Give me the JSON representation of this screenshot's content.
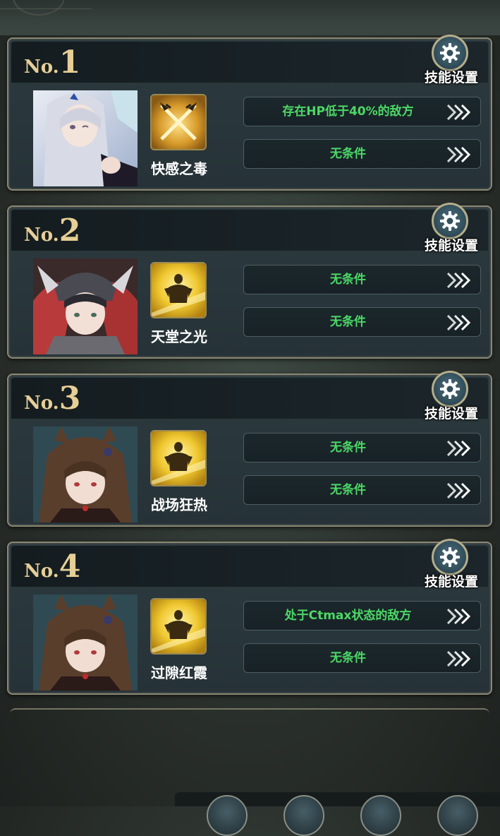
{
  "settings_label": "技能设置",
  "num_prefix": "No.",
  "slots": [
    {
      "number": "1",
      "skill_name": "快感之毒",
      "conditions": [
        "存在HP低于40%的敌方",
        "无条件"
      ]
    },
    {
      "number": "2",
      "skill_name": "天堂之光",
      "conditions": [
        "无条件",
        "无条件"
      ]
    },
    {
      "number": "3",
      "skill_name": "战场狂热",
      "conditions": [
        "无条件",
        "无条件"
      ]
    },
    {
      "number": "4",
      "skill_name": "过隙红霞",
      "conditions": [
        "处于Ctmax状态的敌方",
        "无条件"
      ]
    }
  ],
  "icons": {
    "settings": "gear-icon",
    "arrows": "triple-chevron-right-icon",
    "skill_1": "crossed-daggers-icon",
    "skill_2": "golden-knight-icon",
    "skill_3": "golden-knight-icon",
    "skill_4": "golden-knight-icon"
  },
  "colors": {
    "condition_text": "#4cd866",
    "number_gold": "#e6cf96",
    "frame": "#8c8872"
  }
}
